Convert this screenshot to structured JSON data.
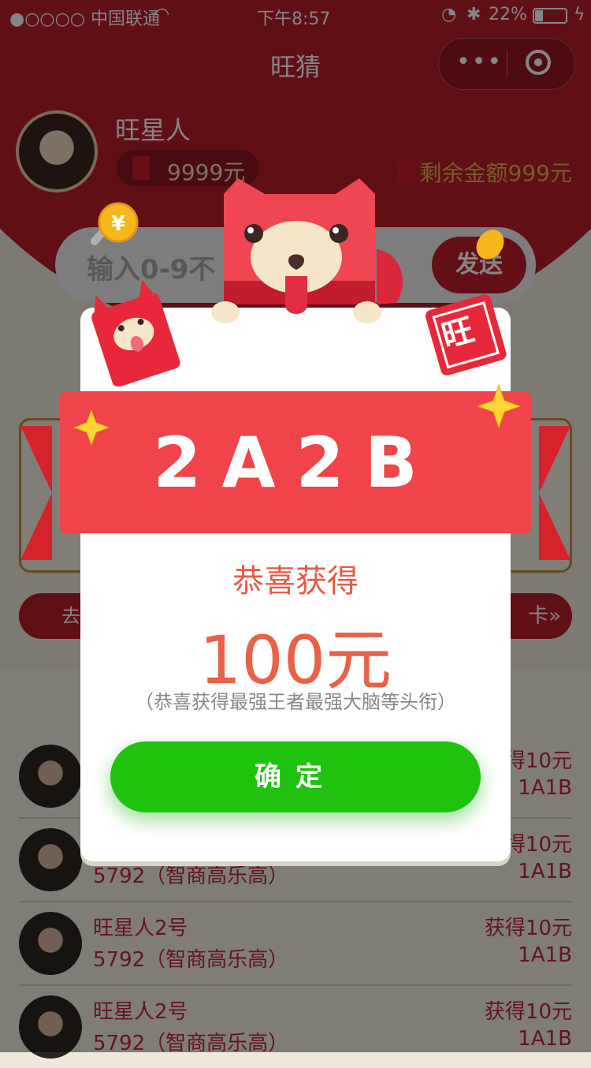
{
  "status_bar": {
    "carrier": "●○○○○ 中国联通",
    "time": "下午8:57",
    "battery": "22%"
  },
  "nav": {
    "title": "旺猜"
  },
  "user": {
    "name": "旺星人",
    "balance": "9999元",
    "remaining": "剩余金额999元"
  },
  "input": {
    "placeholder": "输入0-9不",
    "send": "发送"
  },
  "side_buttons": {
    "left": "去",
    "right": "卡»"
  },
  "modal": {
    "result": "2A2B",
    "congrats": "恭喜获得",
    "amount": "100元",
    "note": "（恭喜获得最强王者最强大脑等头衔）",
    "confirm": "确定",
    "stamp": "旺"
  },
  "list": [
    {
      "name": "",
      "score": "",
      "reward": "得10元",
      "result": "1A1B"
    },
    {
      "name": "",
      "score": "5792（智商高乐高）",
      "reward": "得10元",
      "result": "1A1B"
    },
    {
      "name": "旺星人2号",
      "score": "5792（智商高乐高）",
      "reward": "获得10元",
      "result": "1A1B"
    },
    {
      "name": "旺星人2号",
      "score": "5792（智商高乐高）",
      "reward": "获得10元",
      "result": "1A1B"
    }
  ]
}
